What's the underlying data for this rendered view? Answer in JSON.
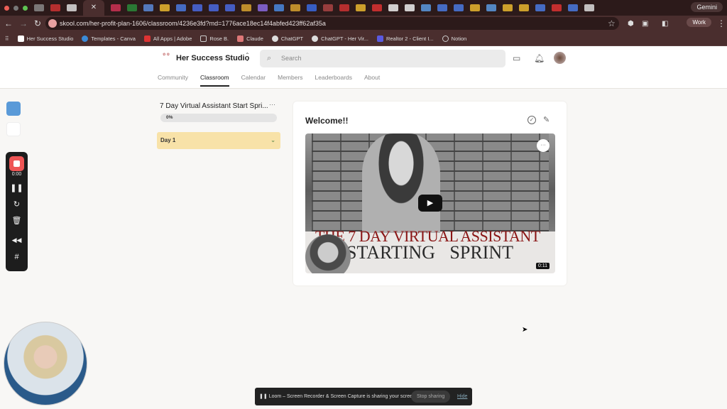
{
  "browser": {
    "url": "skool.com/her-profit-plan-1606/classroom/4236e3fd?md=1776ace18ec14f4abfed423ff62af35a",
    "gemini_label": "Gemini",
    "profile_label": "Work",
    "bookmarks": [
      "Her Success Studio",
      "Templates - Canva",
      "All Apps | Adobe",
      "Rose B.",
      "Claude",
      "ChatGPT",
      "ChatGPT - Her Vir...",
      "Realtor 2 - Client I...",
      "Notion"
    ]
  },
  "header": {
    "brand": "Her Success Studio",
    "logo_text": "Her Success Studio",
    "search_placeholder": "Search",
    "nav": [
      "Community",
      "Classroom",
      "Calendar",
      "Members",
      "Leaderboards",
      "About"
    ],
    "active_nav": "Classroom"
  },
  "course": {
    "title": "7 Day Virtual Assistant Start Spri...",
    "progress_label": "0%",
    "progress": 0,
    "module": "Day 1"
  },
  "lesson": {
    "title": "Welcome!!",
    "video_title_line1": "THE 7 DAY VIRTUAL ASSISTANT",
    "video_title_line2": "STARTING SPRINT",
    "duration": "0:11"
  },
  "loom": {
    "timer": "0:00"
  },
  "share_bar": {
    "message": "Loom – Screen Recorder & Screen Capture is sharing your screen.",
    "stop": "Stop sharing",
    "hide": "Hide"
  },
  "colors": {
    "module_bg": "#f8e2a8",
    "record": "#e55555",
    "brand_text": "#8a1515"
  }
}
